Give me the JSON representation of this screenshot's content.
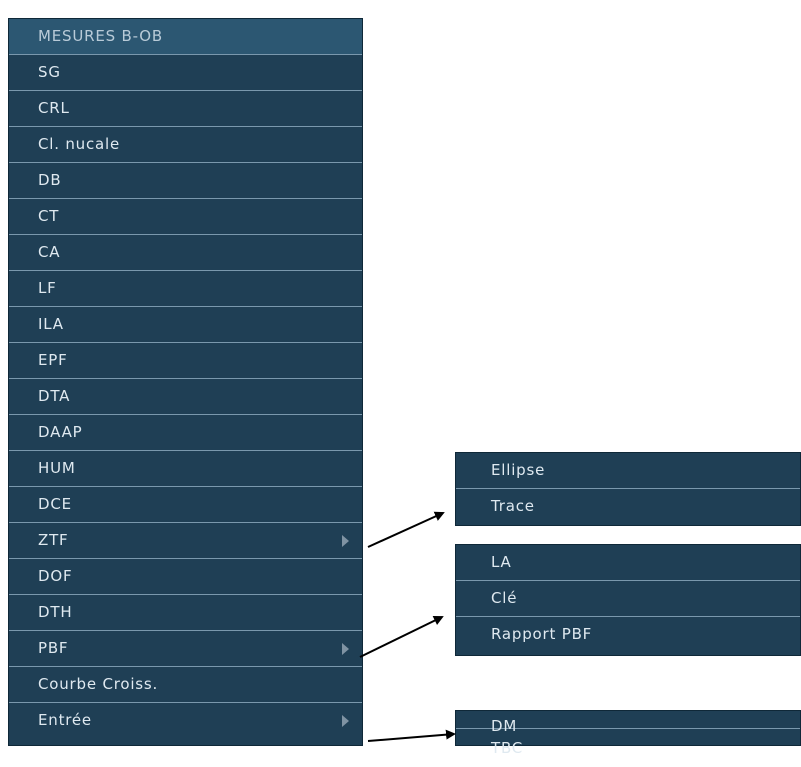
{
  "main_menu": {
    "header": "MESURES B-OB",
    "items": [
      {
        "label": "SG",
        "has_submenu": false
      },
      {
        "label": "CRL",
        "has_submenu": false
      },
      {
        "label": "Cl. nucale",
        "has_submenu": false
      },
      {
        "label": "DB",
        "has_submenu": false
      },
      {
        "label": "CT",
        "has_submenu": false
      },
      {
        "label": "CA",
        "has_submenu": false
      },
      {
        "label": "LF",
        "has_submenu": false
      },
      {
        "label": "ILA",
        "has_submenu": false
      },
      {
        "label": "EPF",
        "has_submenu": false
      },
      {
        "label": "DTA",
        "has_submenu": false
      },
      {
        "label": "DAAP",
        "has_submenu": false
      },
      {
        "label": "HUM",
        "has_submenu": false
      },
      {
        "label": "DCE",
        "has_submenu": false
      },
      {
        "label": "ZTF",
        "has_submenu": true
      },
      {
        "label": "DOF",
        "has_submenu": false
      },
      {
        "label": "DTH",
        "has_submenu": false
      },
      {
        "label": "PBF",
        "has_submenu": true
      },
      {
        "label": "Courbe Croiss.",
        "has_submenu": false
      },
      {
        "label": "Entrée",
        "has_submenu": true
      }
    ]
  },
  "submenu_ztf": {
    "items": [
      "Ellipse",
      "Trace"
    ]
  },
  "submenu_pbf": {
    "items": [
      "LA",
      "Clé",
      "Rapport PBF"
    ]
  },
  "submenu_entree": {
    "items": [
      "DM",
      "TBC"
    ]
  },
  "colors": {
    "menu_bg": "#1f3f55",
    "header_bg": "#2c5772",
    "text": "#dfe9f0",
    "separator": "#7a98ad",
    "submenu_arrow": "#7f93a3"
  },
  "icons": {
    "submenu_indicator": "triangle-right-icon",
    "callout": "arrow-icon"
  }
}
